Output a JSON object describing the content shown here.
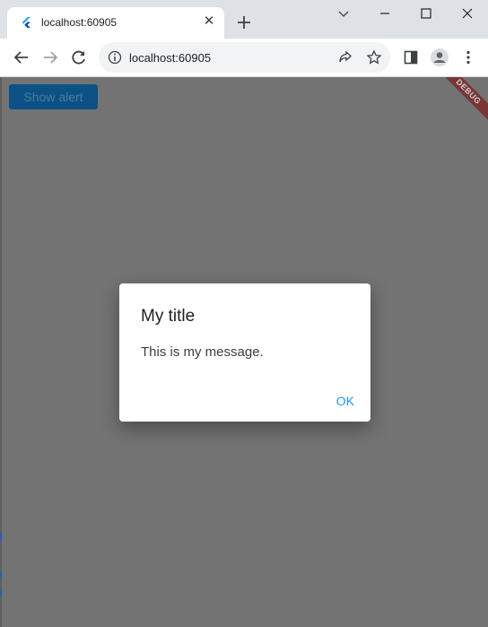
{
  "browser": {
    "tab_title": "localhost:60905",
    "url": "localhost:60905"
  },
  "page": {
    "button_label": "Show alert",
    "debug_label": "DEBUG"
  },
  "dialog": {
    "title": "My title",
    "message": "This is my message.",
    "ok_label": "OK"
  }
}
